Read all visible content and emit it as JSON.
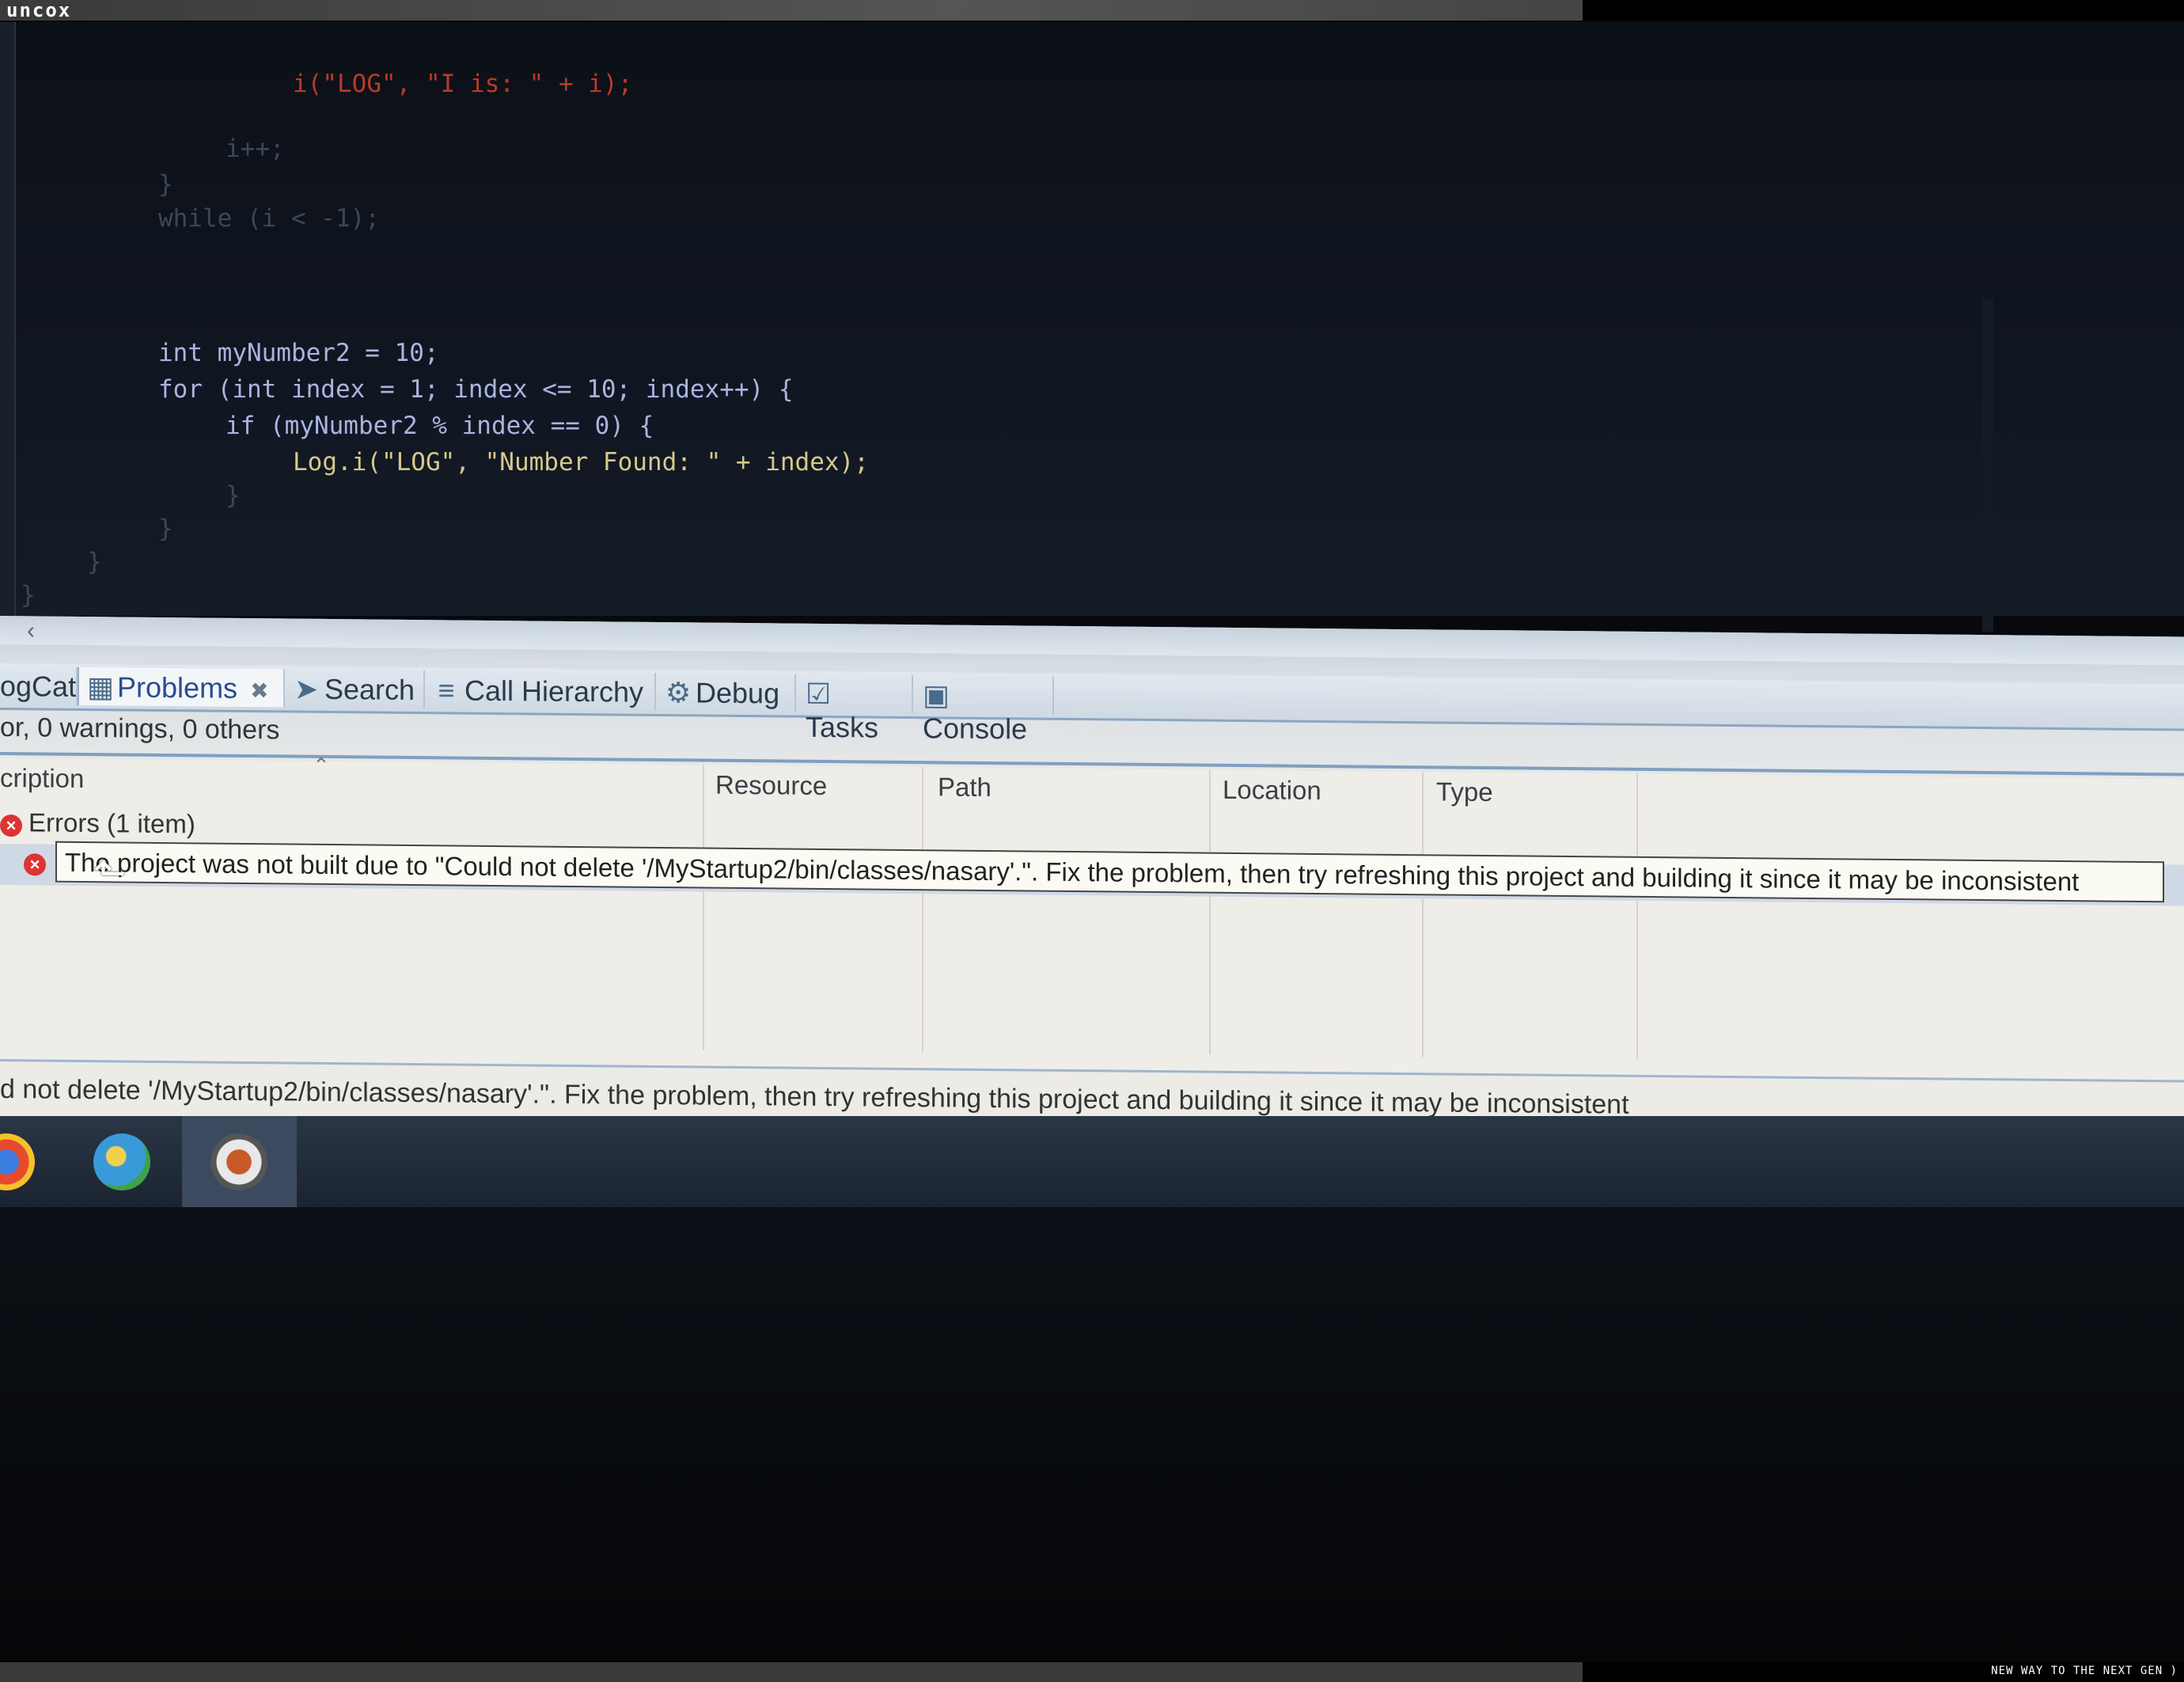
{
  "watermark": {
    "brand": "uncox",
    "tagline": "NEW WAY TO THE NEXT GEN )"
  },
  "code": [
    "i(\"LOG\", \"I is: \" + i);",
    "i++;",
    "}",
    "while (i < -1);",
    "int myNumber2 = 10;",
    "for (int index = 1; index <= 10; index++) {",
    "if (myNumber2 % index == 0) {",
    "Log.i(\"LOG\", \"Number Found: \" + index);",
    "}",
    "}",
    "}",
    "}"
  ],
  "tabs": [
    {
      "label": "ogCat",
      "icon": "logcat-icon"
    },
    {
      "label": "Problems",
      "icon": "problems-icon",
      "active": true
    },
    {
      "label": "Search",
      "icon": "search-icon"
    },
    {
      "label": "Call Hierarchy",
      "icon": "call-hierarchy-icon"
    },
    {
      "label": "Debug",
      "icon": "debug-icon"
    },
    {
      "label": "Tasks",
      "icon": "tasks-icon"
    },
    {
      "label": "Console",
      "icon": "console-icon"
    }
  ],
  "problems": {
    "summary": "or, 0 warnings, 0 others",
    "columns": [
      "cription",
      "Resource",
      "Path",
      "Location",
      "Type"
    ],
    "group": "Errors (1 item)",
    "tooltip": "The project was not built due to \"Could not delete '/MyStartup2/bin/classes/nasary'.\". Fix the problem, then try refreshing this project and building it since it may be inconsistent",
    "status": "d not delete '/MyStartup2/bin/classes/nasary'.\". Fix the problem, then try refreshing this project and building it since it may be inconsistent"
  },
  "colors": {
    "accent": "#2a4d8f",
    "error": "#d33333"
  }
}
